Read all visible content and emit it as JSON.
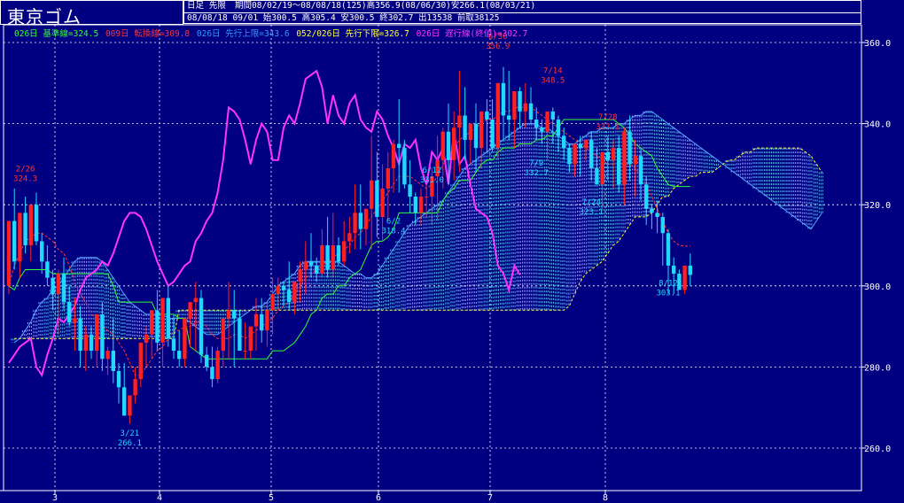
{
  "header": {
    "title": "東京ゴム",
    "period_label": "日足 先限",
    "period_info": "期間08/02/19～08/08/18(125)高356.9(08/06/30)安266.1(08/03/21)",
    "latest_info": "08/08/18 09/01 始300.5 高305.4 安300.5 終302.7 出13538 前取38125"
  },
  "legend": [
    {
      "text": "026日 基準線=324.5",
      "color": "#33ff33"
    },
    {
      "text": "009日 転換線=309.8",
      "color": "#ff3333"
    },
    {
      "text": "026日 先行上限=343.6",
      "color": "#3399ff"
    },
    {
      "text": "052/026日 先行下限=326.7",
      "color": "#ffff33"
    },
    {
      "text": "026日 遅行線(終値)=302.7",
      "color": "#ff33ff"
    }
  ],
  "colors": {
    "up": "#ff2020",
    "down": "#22d8ff",
    "kijun": "#33ff33",
    "tenkan": "#ff3333",
    "chikou": "#ff33ff",
    "span_a": "#55aaff",
    "span_b": "#ffff33",
    "cloud": "#66ccff",
    "grid": "#ffffff",
    "text": "#ffffff"
  },
  "chart_data": {
    "type": "candlestick",
    "title": "東京ゴム",
    "ylim": [
      260,
      362
    ],
    "yticks": [
      "360.0",
      "340.0",
      "320.0",
      "300.0",
      "280.0",
      "260.0"
    ],
    "xticks": [
      "3",
      "4",
      "5",
      "6",
      "7",
      "8"
    ],
    "candles_o": [
      300,
      316,
      306,
      318,
      310,
      320,
      311,
      306,
      302,
      298,
      303,
      296,
      291,
      292,
      284,
      288,
      284,
      293,
      282,
      284,
      279,
      275,
      268,
      273,
      277,
      286,
      288,
      294,
      286,
      297,
      287,
      284,
      282,
      292,
      296,
      297,
      283,
      280,
      277,
      284,
      292,
      294,
      292,
      284,
      284,
      290,
      293,
      289,
      294,
      298,
      300,
      299,
      296,
      301,
      304,
      306,
      305,
      303,
      310,
      304,
      310,
      306,
      311,
      313,
      318,
      314,
      319,
      326,
      317,
      324,
      329,
      335,
      334,
      325,
      322,
      318,
      322,
      322,
      327,
      331,
      338,
      331,
      339,
      342,
      336,
      340,
      334,
      343,
      341,
      334,
      350,
      342,
      341,
      348,
      343,
      345,
      341,
      339,
      338,
      343,
      341,
      337,
      334,
      330,
      335,
      334,
      336,
      329,
      325,
      333,
      331,
      334,
      325,
      338,
      330,
      332,
      325,
      319,
      318,
      317,
      313,
      305,
      303,
      299,
      305
    ],
    "candles_h": [
      302,
      324,
      318,
      322,
      316,
      323,
      313,
      310,
      304,
      304,
      307,
      300,
      297,
      295,
      290,
      290,
      289,
      296,
      285,
      292,
      281,
      281,
      271,
      280,
      279,
      290,
      294,
      299,
      292,
      300,
      293,
      289,
      292,
      294,
      301,
      299,
      285,
      285,
      285,
      291,
      301,
      299,
      294,
      291,
      289,
      297,
      297,
      296,
      302,
      302,
      301,
      306,
      301,
      306,
      311,
      313,
      307,
      314,
      317,
      318,
      312,
      316,
      317,
      325,
      325,
      318,
      337,
      333,
      330,
      333,
      336,
      346,
      336,
      331,
      323,
      324,
      325,
      329,
      337,
      339,
      345,
      343,
      353,
      349,
      340,
      345,
      343,
      346,
      346,
      348,
      354,
      353,
      343,
      349,
      350,
      349,
      344,
      341,
      341,
      344,
      342,
      339,
      335,
      334,
      337,
      336,
      338,
      334,
      328,
      337,
      336,
      337,
      339,
      342,
      336,
      334,
      327,
      320,
      321,
      318,
      314,
      307,
      304,
      304,
      308
    ],
    "candles_l": [
      298,
      304,
      302,
      308,
      306,
      310,
      303,
      300,
      294,
      288,
      294,
      290,
      284,
      280,
      279,
      282,
      280,
      279,
      278,
      276,
      271,
      268,
      266,
      271,
      275,
      280,
      282,
      284,
      280,
      285,
      282,
      280,
      280,
      285,
      284,
      281,
      279,
      275,
      276,
      280,
      282,
      280,
      284,
      282,
      282,
      284,
      286,
      285,
      288,
      294,
      295,
      294,
      293,
      296,
      298,
      302,
      301,
      302,
      302,
      302,
      305,
      305,
      308,
      309,
      309,
      310,
      309,
      312,
      311,
      316,
      323,
      323,
      324,
      318,
      315,
      315,
      317,
      315,
      316,
      324,
      325,
      326,
      328,
      331,
      330,
      328,
      329,
      333,
      333,
      331,
      336,
      336,
      334,
      339,
      339,
      340,
      336,
      335,
      331,
      335,
      333,
      331,
      328,
      327,
      327,
      331,
      326,
      325,
      319,
      326,
      324,
      323,
      320,
      326,
      322,
      321,
      315,
      314,
      313,
      305,
      298,
      298,
      300,
      298,
      300
    ],
    "candles_c": [
      316,
      306,
      318,
      310,
      320,
      311,
      306,
      302,
      298,
      303,
      296,
      291,
      292,
      284,
      288,
      284,
      293,
      282,
      284,
      279,
      275,
      268,
      273,
      277,
      286,
      288,
      294,
      286,
      297,
      287,
      284,
      282,
      292,
      296,
      297,
      283,
      280,
      277,
      284,
      292,
      294,
      292,
      284,
      284,
      290,
      293,
      289,
      294,
      298,
      300,
      299,
      296,
      301,
      304,
      306,
      305,
      303,
      310,
      304,
      310,
      306,
      311,
      313,
      318,
      314,
      319,
      326,
      317,
      324,
      329,
      335,
      334,
      325,
      322,
      318,
      322,
      322,
      327,
      331,
      338,
      331,
      339,
      342,
      336,
      340,
      334,
      343,
      341,
      334,
      350,
      342,
      341,
      348,
      343,
      345,
      341,
      339,
      338,
      343,
      341,
      337,
      334,
      330,
      335,
      334,
      336,
      329,
      325,
      333,
      331,
      334,
      325,
      338,
      330,
      332,
      325,
      319,
      318,
      317,
      313,
      305,
      303,
      299,
      305,
      302.7
    ],
    "kijun": [
      300,
      299,
      302,
      304,
      304,
      304,
      304,
      304,
      303,
      303,
      303,
      303,
      303,
      303,
      303,
      303,
      303,
      303,
      303,
      300,
      296,
      296,
      296,
      296,
      296,
      296,
      296,
      293,
      293,
      293,
      293,
      292,
      292,
      285,
      284,
      283,
      282,
      282,
      282,
      282,
      282,
      282,
      282,
      282,
      282,
      282,
      282,
      282,
      284,
      284,
      284,
      285,
      286,
      288,
      290,
      293,
      294,
      297,
      298,
      298,
      300,
      300,
      302,
      303,
      304,
      307,
      310,
      311,
      311,
      312,
      314,
      318,
      318,
      318,
      318,
      318,
      318,
      318,
      318,
      321,
      323,
      324,
      326,
      326,
      326,
      328,
      330,
      331,
      331,
      333,
      334,
      334,
      334,
      335,
      335,
      335,
      336,
      336,
      337,
      337,
      339,
      341,
      341,
      341,
      341,
      341,
      341,
      341,
      341,
      341,
      341,
      340,
      339,
      337,
      335,
      334,
      333,
      332,
      329,
      327,
      325,
      324.5,
      324.5,
      324.5,
      324.5
    ],
    "tenkan": [
      300,
      305,
      308,
      311,
      312,
      313,
      313,
      312,
      311,
      309,
      308,
      305,
      301,
      298,
      296,
      293,
      292,
      290,
      289,
      288,
      286,
      284,
      281,
      278,
      278,
      280,
      282,
      284,
      285,
      287,
      289,
      289,
      290,
      290,
      291,
      291,
      290,
      288,
      287,
      287,
      287,
      288,
      288,
      287,
      288,
      289,
      290,
      291,
      292,
      294,
      295,
      296,
      298,
      300,
      302,
      303,
      304,
      305,
      306,
      307,
      308,
      309,
      310,
      312,
      313,
      315,
      317,
      319,
      321,
      323,
      325,
      327,
      327,
      327,
      326,
      325,
      324,
      325,
      327,
      330,
      332,
      334,
      336,
      337,
      338,
      339,
      340,
      341,
      341,
      342,
      343,
      343,
      344,
      344,
      344,
      344,
      343,
      342,
      341,
      340,
      339,
      338,
      337,
      336,
      335,
      334,
      333,
      332,
      331,
      330,
      330,
      330,
      330,
      330,
      329,
      327,
      325,
      322,
      319,
      316,
      313,
      311,
      310,
      309.8,
      309.8
    ],
    "chikou": [
      281,
      283,
      285,
      286,
      287,
      280,
      278,
      283,
      287,
      292,
      291,
      293,
      295,
      299,
      302,
      303,
      304,
      306,
      305,
      308,
      312,
      316,
      318,
      318,
      317,
      314,
      310,
      306,
      303,
      300,
      301,
      303,
      305,
      306,
      311,
      313,
      316,
      318,
      323,
      331,
      344,
      343,
      341,
      336,
      330,
      336,
      340,
      338,
      331,
      331,
      339,
      342,
      340,
      345,
      351,
      352,
      353,
      349,
      340,
      347,
      342,
      340,
      345,
      347,
      341,
      339,
      338,
      343,
      341,
      337,
      334,
      330,
      335,
      334,
      336,
      329,
      325,
      333,
      331,
      334,
      325,
      338,
      330,
      332,
      325,
      319,
      318,
      317,
      313,
      305,
      303,
      299,
      305,
      302.7
    ],
    "span_a": [
      286,
      287,
      289,
      291,
      294,
      296,
      297,
      299,
      300,
      302,
      304,
      306,
      307,
      307,
      307,
      307,
      306,
      304,
      302,
      300,
      298,
      296,
      295,
      294,
      293,
      293,
      293,
      293,
      292,
      292,
      292,
      292,
      291,
      290,
      289,
      288,
      288,
      288,
      289,
      290,
      291,
      292,
      293,
      294,
      295,
      295,
      296,
      298,
      300,
      301,
      302,
      303,
      305,
      306,
      306,
      306,
      306,
      306,
      306,
      306,
      305,
      304,
      303,
      303,
      302,
      302,
      303,
      305,
      307,
      309,
      311,
      313,
      315,
      316,
      317,
      318,
      319,
      320,
      321,
      323,
      325,
      327,
      329,
      330,
      331,
      332,
      333,
      334,
      335,
      336,
      337,
      338,
      339,
      340,
      340,
      340,
      339,
      339,
      338,
      337,
      336,
      335,
      335,
      336,
      337,
      338,
      338,
      339,
      339,
      339,
      340,
      340,
      341,
      342,
      342,
      343,
      343,
      342,
      341,
      340,
      339,
      338,
      337,
      336,
      335,
      334,
      333,
      332,
      331,
      330,
      329,
      328,
      327,
      326,
      325,
      324,
      323,
      322,
      321,
      320,
      319,
      318,
      317,
      316,
      315,
      314,
      316,
      318
    ],
    "span_b": [
      287,
      287,
      287,
      287,
      287,
      287,
      287,
      287,
      287,
      287,
      287,
      287,
      287,
      287,
      287,
      287,
      287,
      287,
      287,
      287,
      287,
      287,
      287,
      287,
      287,
      287,
      287,
      287,
      287,
      287,
      294,
      294,
      294,
      294,
      294,
      294,
      294,
      294,
      294,
      294,
      294,
      294,
      294,
      294,
      294,
      294,
      294,
      294,
      294,
      294,
      294,
      294,
      294,
      294,
      294,
      294,
      294,
      294,
      294,
      294,
      294,
      294,
      294,
      294,
      294,
      294,
      294,
      294,
      294,
      294,
      294,
      294,
      294,
      294,
      294,
      294,
      294,
      294,
      294,
      294,
      294,
      294,
      294,
      294,
      294,
      294,
      294,
      294,
      294,
      294,
      294,
      294,
      294,
      294,
      294,
      294,
      294,
      294,
      294,
      294,
      294,
      295,
      298,
      301,
      303,
      304,
      305,
      306,
      308,
      310,
      311,
      313,
      315,
      317,
      317,
      317,
      318,
      320,
      322,
      322,
      324,
      325,
      326,
      327,
      327,
      328,
      328,
      328,
      329,
      330,
      331,
      331,
      332,
      333,
      333,
      334,
      334,
      334,
      334,
      334,
      334,
      334,
      334,
      334,
      333,
      332,
      330,
      328
    ],
    "annotations": [
      {
        "date": "2/26",
        "value": "324.3",
        "i": 3,
        "price": 324.3,
        "color": "#ff3333",
        "pos": "above"
      },
      {
        "date": "3/21",
        "value": "266.1",
        "i": 22,
        "price": 266.1,
        "color": "#22d8ff",
        "pos": "below"
      },
      {
        "date": "6/30",
        "value": "356.9",
        "i": 89,
        "price": 356.9,
        "color": "#ff3333",
        "pos": "above"
      },
      {
        "date": "7/14",
        "value": "348.5",
        "i": 99,
        "price": 348.5,
        "color": "#ff3333",
        "pos": "above"
      },
      {
        "date": "7/28",
        "value": "337.1",
        "i": 109,
        "price": 337.1,
        "color": "#ff3333",
        "pos": "above"
      },
      {
        "date": "6/2",
        "value": "318.4",
        "i": 70,
        "price": 318.4,
        "color": "#22d8ff",
        "pos": "below"
      },
      {
        "date": "6/12",
        "value": "331.0",
        "i": 77,
        "price": 331.0,
        "color": "#22d8ff",
        "pos": "below"
      },
      {
        "date": "7/9",
        "value": "332.7",
        "i": 96,
        "price": 332.7,
        "color": "#22d8ff",
        "pos": "below"
      },
      {
        "date": "7/24",
        "value": "323.1",
        "i": 106,
        "price": 323.1,
        "color": "#22d8ff",
        "pos": "below"
      },
      {
        "date": "8/12",
        "value": "303.1",
        "i": 120,
        "price": 303.1,
        "color": "#22d8ff",
        "pos": "below"
      }
    ]
  }
}
